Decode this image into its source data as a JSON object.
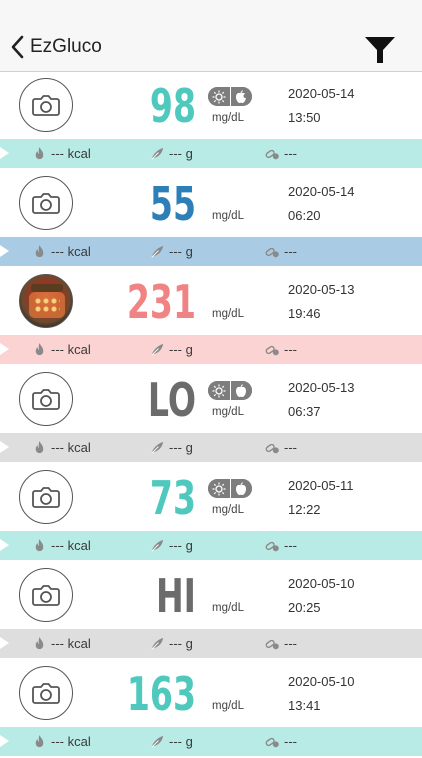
{
  "header": {
    "title": "EzGluco"
  },
  "placeholders": {
    "kcal": "--- kcal",
    "carb": "--- g",
    "med": "---"
  },
  "colors": {
    "teal": "#4fc9bd",
    "teal_band": "#b8ebe5",
    "blue": "#2d7fb8",
    "blue_band": "#a9cce4",
    "red": "#f08484",
    "red_band": "#fcd3d3",
    "gray": "#6b6b6b",
    "gray_band": "#dedede"
  },
  "entries": [
    {
      "value": "98",
      "unit": "mg/dL",
      "date": "2020-05-14",
      "time": "13:50",
      "meal": "after-meal",
      "photo": "camera-icon",
      "color": "teal"
    },
    {
      "value": "55",
      "unit": "mg/dL",
      "date": "2020-05-14",
      "time": "06:20",
      "meal": "none",
      "photo": "camera-icon",
      "color": "blue"
    },
    {
      "value": "231",
      "unit": "mg/dL",
      "date": "2020-05-13",
      "time": "19:46",
      "meal": "none",
      "photo": "food-photo",
      "color": "red"
    },
    {
      "value": "LO",
      "unit": "mg/dL",
      "date": "2020-05-13",
      "time": "06:37",
      "meal": "before-meal",
      "photo": "camera-icon",
      "color": "gray"
    },
    {
      "value": "73",
      "unit": "mg/dL",
      "date": "2020-05-11",
      "time": "12:22",
      "meal": "before-meal",
      "photo": "camera-icon",
      "color": "teal"
    },
    {
      "value": "HI",
      "unit": "mg/dL",
      "date": "2020-05-10",
      "time": "20:25",
      "meal": "none",
      "photo": "camera-icon",
      "color": "gray"
    },
    {
      "value": "163",
      "unit": "mg/dL",
      "date": "2020-05-10",
      "time": "13:41",
      "meal": "none",
      "photo": "camera-icon",
      "color": "teal"
    }
  ]
}
